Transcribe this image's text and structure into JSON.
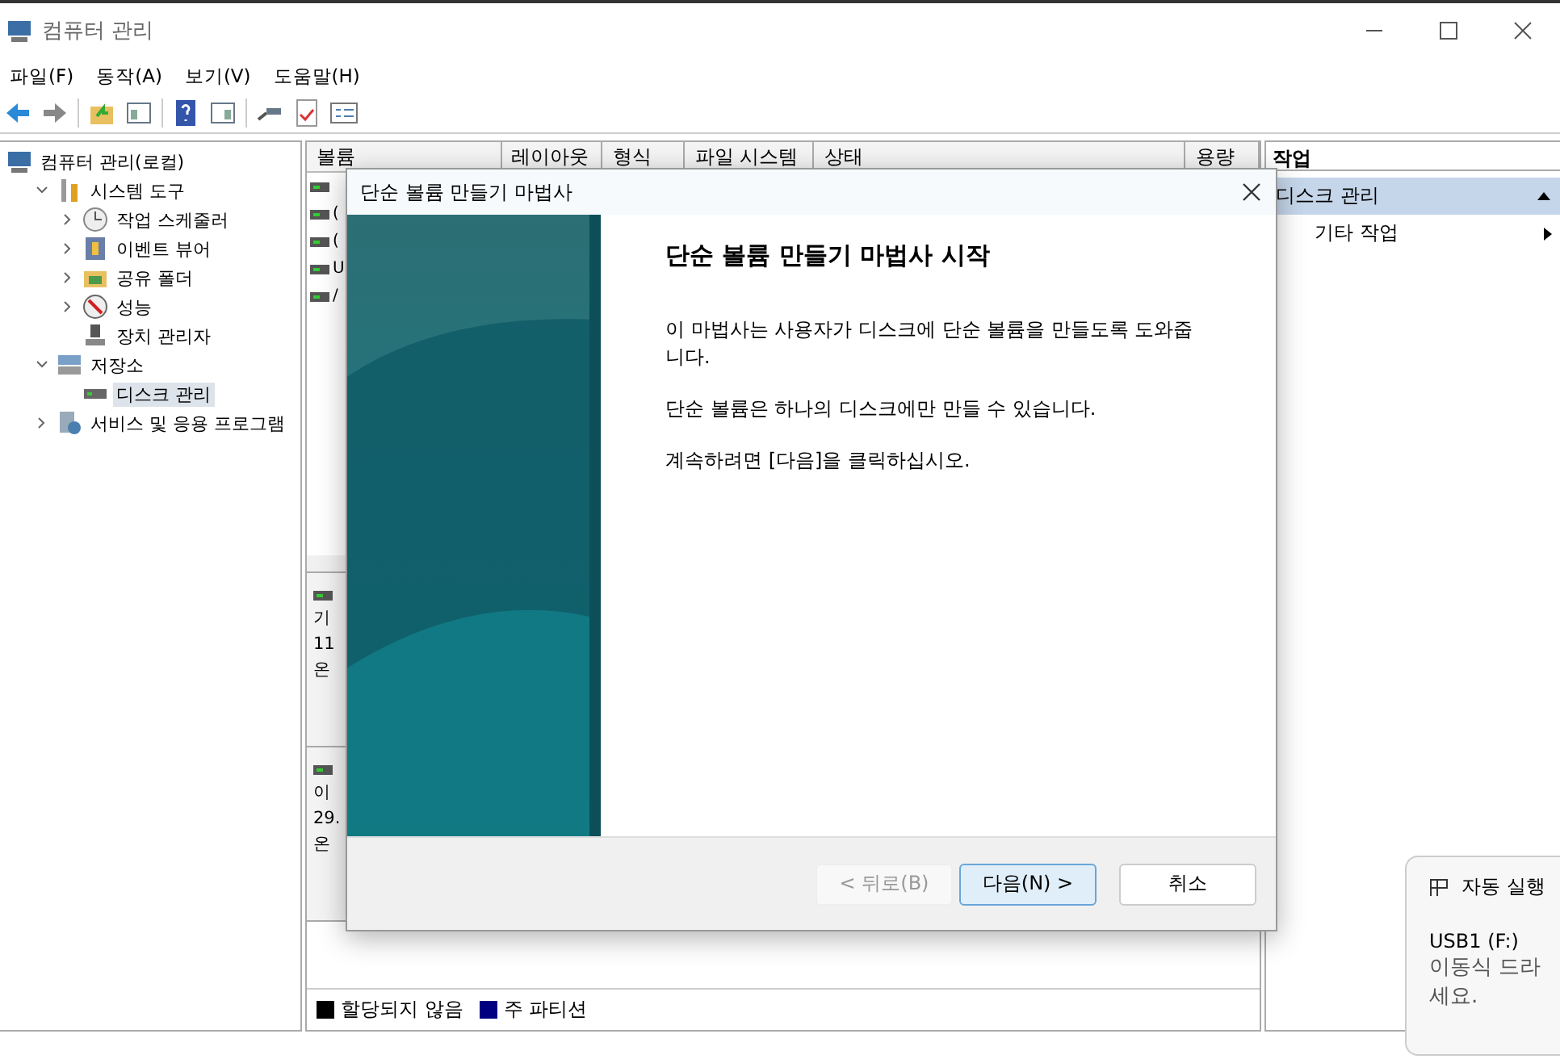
{
  "window": {
    "title": "컴퓨터 관리"
  },
  "menu": [
    "파일(F)",
    "동작(A)",
    "보기(V)",
    "도움말(H)"
  ],
  "tree": [
    {
      "label": "컴퓨터 관리(로컬)",
      "selected": false,
      "children": [
        {
          "label": "시스템 도구",
          "expanded": true,
          "selected": false,
          "children": [
            {
              "label": "작업 스케줄러",
              "expanded": false,
              "selected": false
            },
            {
              "label": "이벤트 뷰어",
              "expanded": false,
              "selected": false
            },
            {
              "label": "공유 폴더",
              "expanded": false,
              "selected": false
            },
            {
              "label": "성능",
              "expanded": false,
              "selected": false
            },
            {
              "label": "장치 관리자",
              "selected": false
            }
          ]
        },
        {
          "label": "저장소",
          "expanded": true,
          "selected": false,
          "children": [
            {
              "label": "디스크 관리",
              "selected": true
            }
          ]
        },
        {
          "label": "서비스 및 응용 프로그램",
          "expanded": false,
          "selected": false
        }
      ]
    }
  ],
  "volume_table": {
    "columns": [
      "볼륨",
      "레이아웃",
      "형식",
      "파일 시스템",
      "상태",
      "용량"
    ],
    "rows": [
      {
        "label": ""
      },
      {
        "label": "("
      },
      {
        "label": "("
      },
      {
        "label": "U"
      },
      {
        "label": "/"
      }
    ]
  },
  "disks": [
    {
      "lines": [
        "기",
        "11",
        "온"
      ]
    },
    {
      "lines": [
        "이",
        "29.",
        "온"
      ]
    }
  ],
  "legend": [
    {
      "label": "할당되지 않음",
      "color": "#000000"
    },
    {
      "label": "주 파티션",
      "color": "#000080"
    }
  ],
  "actions": {
    "header": "작업",
    "sections": [
      {
        "label": "디스크 관리",
        "expanded": true,
        "items": [
          "기타 작업"
        ]
      }
    ]
  },
  "dialog": {
    "title": "단순 볼륨 만들기 마법사",
    "heading": "단순 볼륨 만들기 마법사 시작",
    "paragraphs": [
      "이 마법사는 사용자가 디스크에 단순 볼륨을 만들도록 도와줍니다.",
      "단순 볼륨은 하나의 디스크에만 만들 수 있습니다.",
      "계속하려면 [다음]을 클릭하십시오."
    ],
    "buttons": [
      {
        "label": "< 뒤로(B)",
        "disabled": true,
        "focused": false
      },
      {
        "label": "다음(N) >",
        "disabled": false,
        "focused": true
      },
      {
        "label": "취소",
        "disabled": false,
        "focused": false
      }
    ]
  },
  "toast": {
    "title": "자동 실행",
    "device": "USB1 (F:)",
    "lines": [
      "이동식 드라",
      "세요."
    ]
  }
}
